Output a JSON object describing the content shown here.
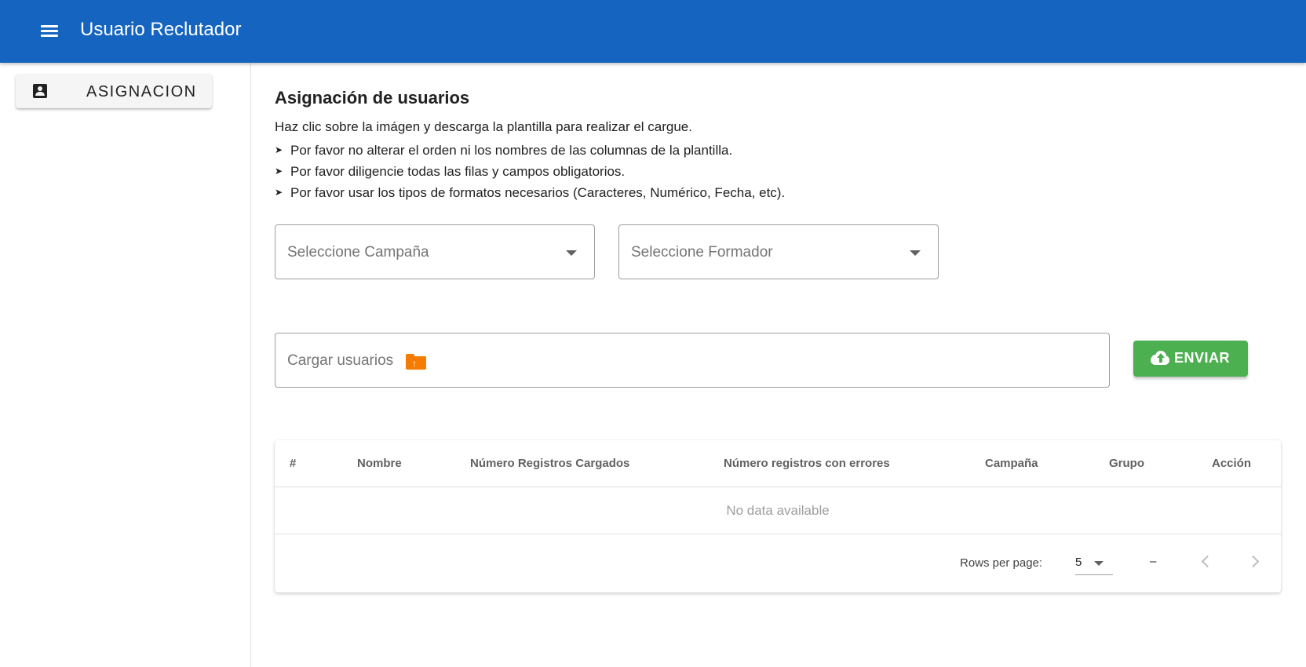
{
  "appbar": {
    "title": "Usuario Reclutador"
  },
  "sidebar": {
    "items": [
      {
        "label": "ASIGNACION",
        "icon": "account-box-icon"
      }
    ]
  },
  "main": {
    "title": "Asignación de usuarios",
    "intro": "Haz clic sobre la imágen y descarga la plantilla para realizar el cargue.",
    "bullets": [
      "Por favor no alterar el orden ni los nombres de las columnas de la plantilla.",
      "Por favor diligencie todas las filas y campos obligatorios.",
      "Por favor usar los tipos de formatos necesarios (Caracteres, Numérico, Fecha, etc)."
    ],
    "selects": {
      "campana_placeholder": "Seleccione Campaña",
      "formador_placeholder": "Seleccione Formador"
    },
    "upload": {
      "placeholder": "Cargar usuarios"
    },
    "send_label": "ENVIAR"
  },
  "table": {
    "headers": [
      "#",
      "Nombre",
      "Número Registros Cargados",
      "Número registros con errores",
      "Campaña",
      "Grupo",
      "Acción"
    ],
    "empty_text": "No data available",
    "rows_per_page_label": "Rows per page:",
    "rows_per_page_value": "5",
    "range_text": "–"
  },
  "colors": {
    "appbar": "#1565c0",
    "send_button": "#4caf50",
    "upload_icon": "#f57c00"
  }
}
